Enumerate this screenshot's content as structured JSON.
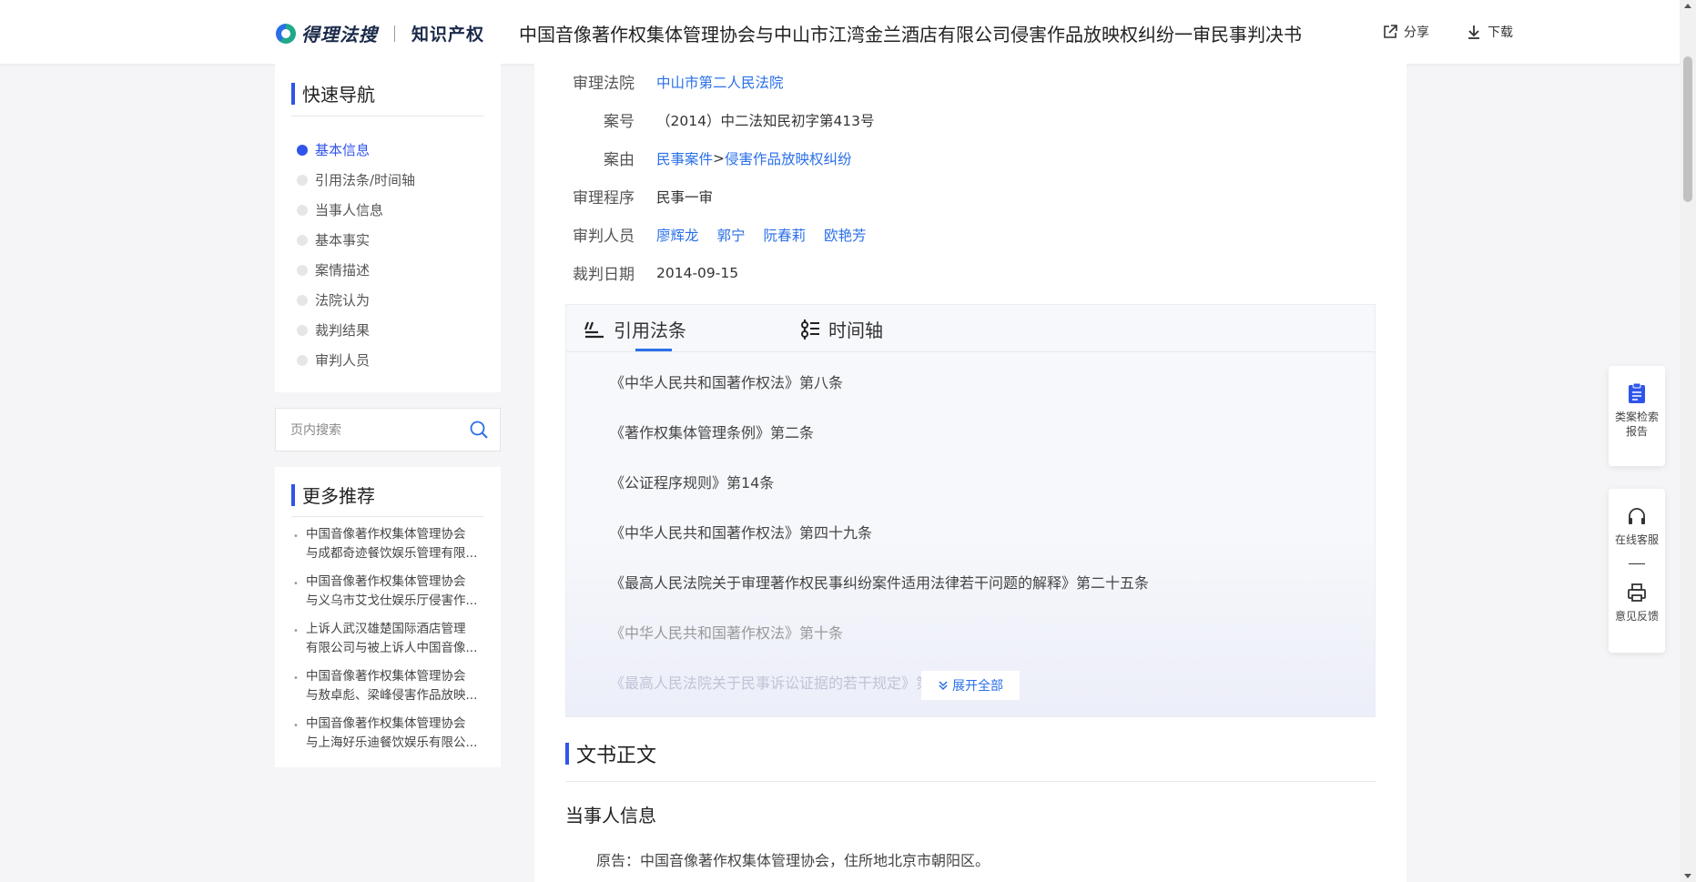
{
  "header": {
    "logo_text": "得理法搜",
    "logo_sub": "知识产权",
    "title": "中国音像著作权集体管理协会与中山市江湾金兰酒店有限公司侵害作品放映权纠纷一审民事判决书",
    "share_label": "分享",
    "download_label": "下载"
  },
  "nav": {
    "title": "快速导航",
    "items": [
      "基本信息",
      "引用法条/时间轴",
      "当事人信息",
      "基本事实",
      "案情描述",
      "法院认为",
      "裁判结果",
      "审判人员"
    ],
    "active_index": 0
  },
  "search": {
    "placeholder": "页内搜索"
  },
  "recommend": {
    "title": "更多推荐",
    "items": [
      {
        "line1": "中国音像著作权集体管理协会",
        "line2": "与成都奇迹餐饮娱乐管理有限..."
      },
      {
        "line1": "中国音像著作权集体管理协会",
        "line2": "与义乌市艾戈仕娱乐厅侵害作..."
      },
      {
        "line1": "上诉人武汉雄楚国际酒店管理",
        "line2": "有限公司与被上诉人中国音像..."
      },
      {
        "line1": "中国音像著作权集体管理协会",
        "line2": "与敖卓彪、梁峰侵害作品放映..."
      },
      {
        "line1": "中国音像著作权集体管理协会",
        "line2": "与上海好乐迪餐饮娱乐有限公..."
      }
    ]
  },
  "info": {
    "court_label": "审理法院",
    "court_value": "中山市第二人民法院",
    "case_no_label": "案号",
    "case_no_value": "（2014）中二法知民初字第413号",
    "cause_label": "案由",
    "cause_value_1": "民事案件",
    "cause_sep": ">",
    "cause_value_2": "侵害作品放映权纠纷",
    "procedure_label": "审理程序",
    "procedure_value": "民事一审",
    "judges_label": "审判人员",
    "judges": [
      "廖辉龙",
      "郭宁",
      "阮春莉",
      "欧艳芳"
    ],
    "date_label": "裁判日期",
    "date_value": "2014-09-15"
  },
  "laws": {
    "tab_laws": "引用法条",
    "tab_timeline": "时间轴",
    "items": [
      "《中华人民共和国著作权法》第八条",
      "《著作权集体管理条例》第二条",
      "《公证程序规则》第14条",
      "《中华人民共和国著作权法》第四十九条",
      "《最高人民法院关于审理著作权民事纠纷案件适用法律若干问题的解释》第二十五条",
      "《中华人民共和国著作权法》第十条",
      "《最高人民法院关于民事诉讼证据的若干规定》第"
    ],
    "expand_label": "展开全部"
  },
  "document": {
    "title": "文书正文",
    "party_title": "当事人信息",
    "party_line": "原告：中国音像著作权集体管理协会，住所地北京市朝阳区。"
  },
  "float": {
    "report_label_1": "类案检索",
    "report_label_2": "报告",
    "service_label": "在线客服",
    "feedback_label": "意见反馈"
  },
  "colors": {
    "accent": "#2f54eb",
    "link": "#2a6fe8"
  }
}
